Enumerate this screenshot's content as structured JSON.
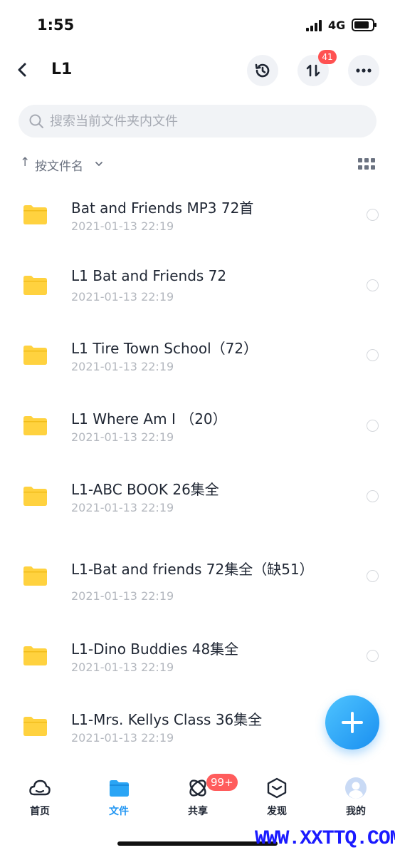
{
  "status_bar": {
    "time": "1:55",
    "network": "4G",
    "battery_level": 0.85
  },
  "nav": {
    "title": "L1",
    "transfer_badge": "41",
    "icons": [
      "back-icon",
      "history-icon",
      "transfer-icon",
      "more-icon"
    ]
  },
  "search": {
    "placeholder": "搜索当前文件夹内文件"
  },
  "sort": {
    "arrow": "↑",
    "label": "按文件名"
  },
  "files": [
    {
      "name": "Bat and Friends  MP3 72首",
      "date": "2021-01-13 22:19"
    },
    {
      "name": "L1 Bat and Friends 72",
      "date": "2021-01-13 22:19"
    },
    {
      "name": "L1 Tire Town School（72）",
      "date": "2021-01-13 22:19"
    },
    {
      "name": "L1 Where Am I （20）",
      "date": "2021-01-13 22:19"
    },
    {
      "name": "L1-ABC BOOK 26集全",
      "date": "2021-01-13 22:19"
    },
    {
      "name": "L1-Bat and friends 72集全（缺51）",
      "date": "2021-01-13 22:19"
    },
    {
      "name": "L1-Dino Buddies 48集全",
      "date": "2021-01-13 22:19"
    },
    {
      "name": "L1-Mrs. Kellys Class 36集全",
      "date": "2021-01-13 22:19"
    }
  ],
  "tabbar": {
    "tabs": [
      {
        "label": "首页",
        "icon": "cloud-icon"
      },
      {
        "label": "文件",
        "icon": "folder-icon",
        "active": true
      },
      {
        "label": "共享",
        "icon": "share-orbit-icon"
      },
      {
        "label": "发现",
        "icon": "discover-box-icon"
      },
      {
        "label": "我的",
        "icon": "avatar-icon"
      }
    ],
    "share_badge": "99+"
  },
  "watermark": "WWW.XXTTQ.COM",
  "colors": {
    "accent": "#2196f3",
    "folder": "#ffd23f",
    "badge": "#ff5151"
  }
}
